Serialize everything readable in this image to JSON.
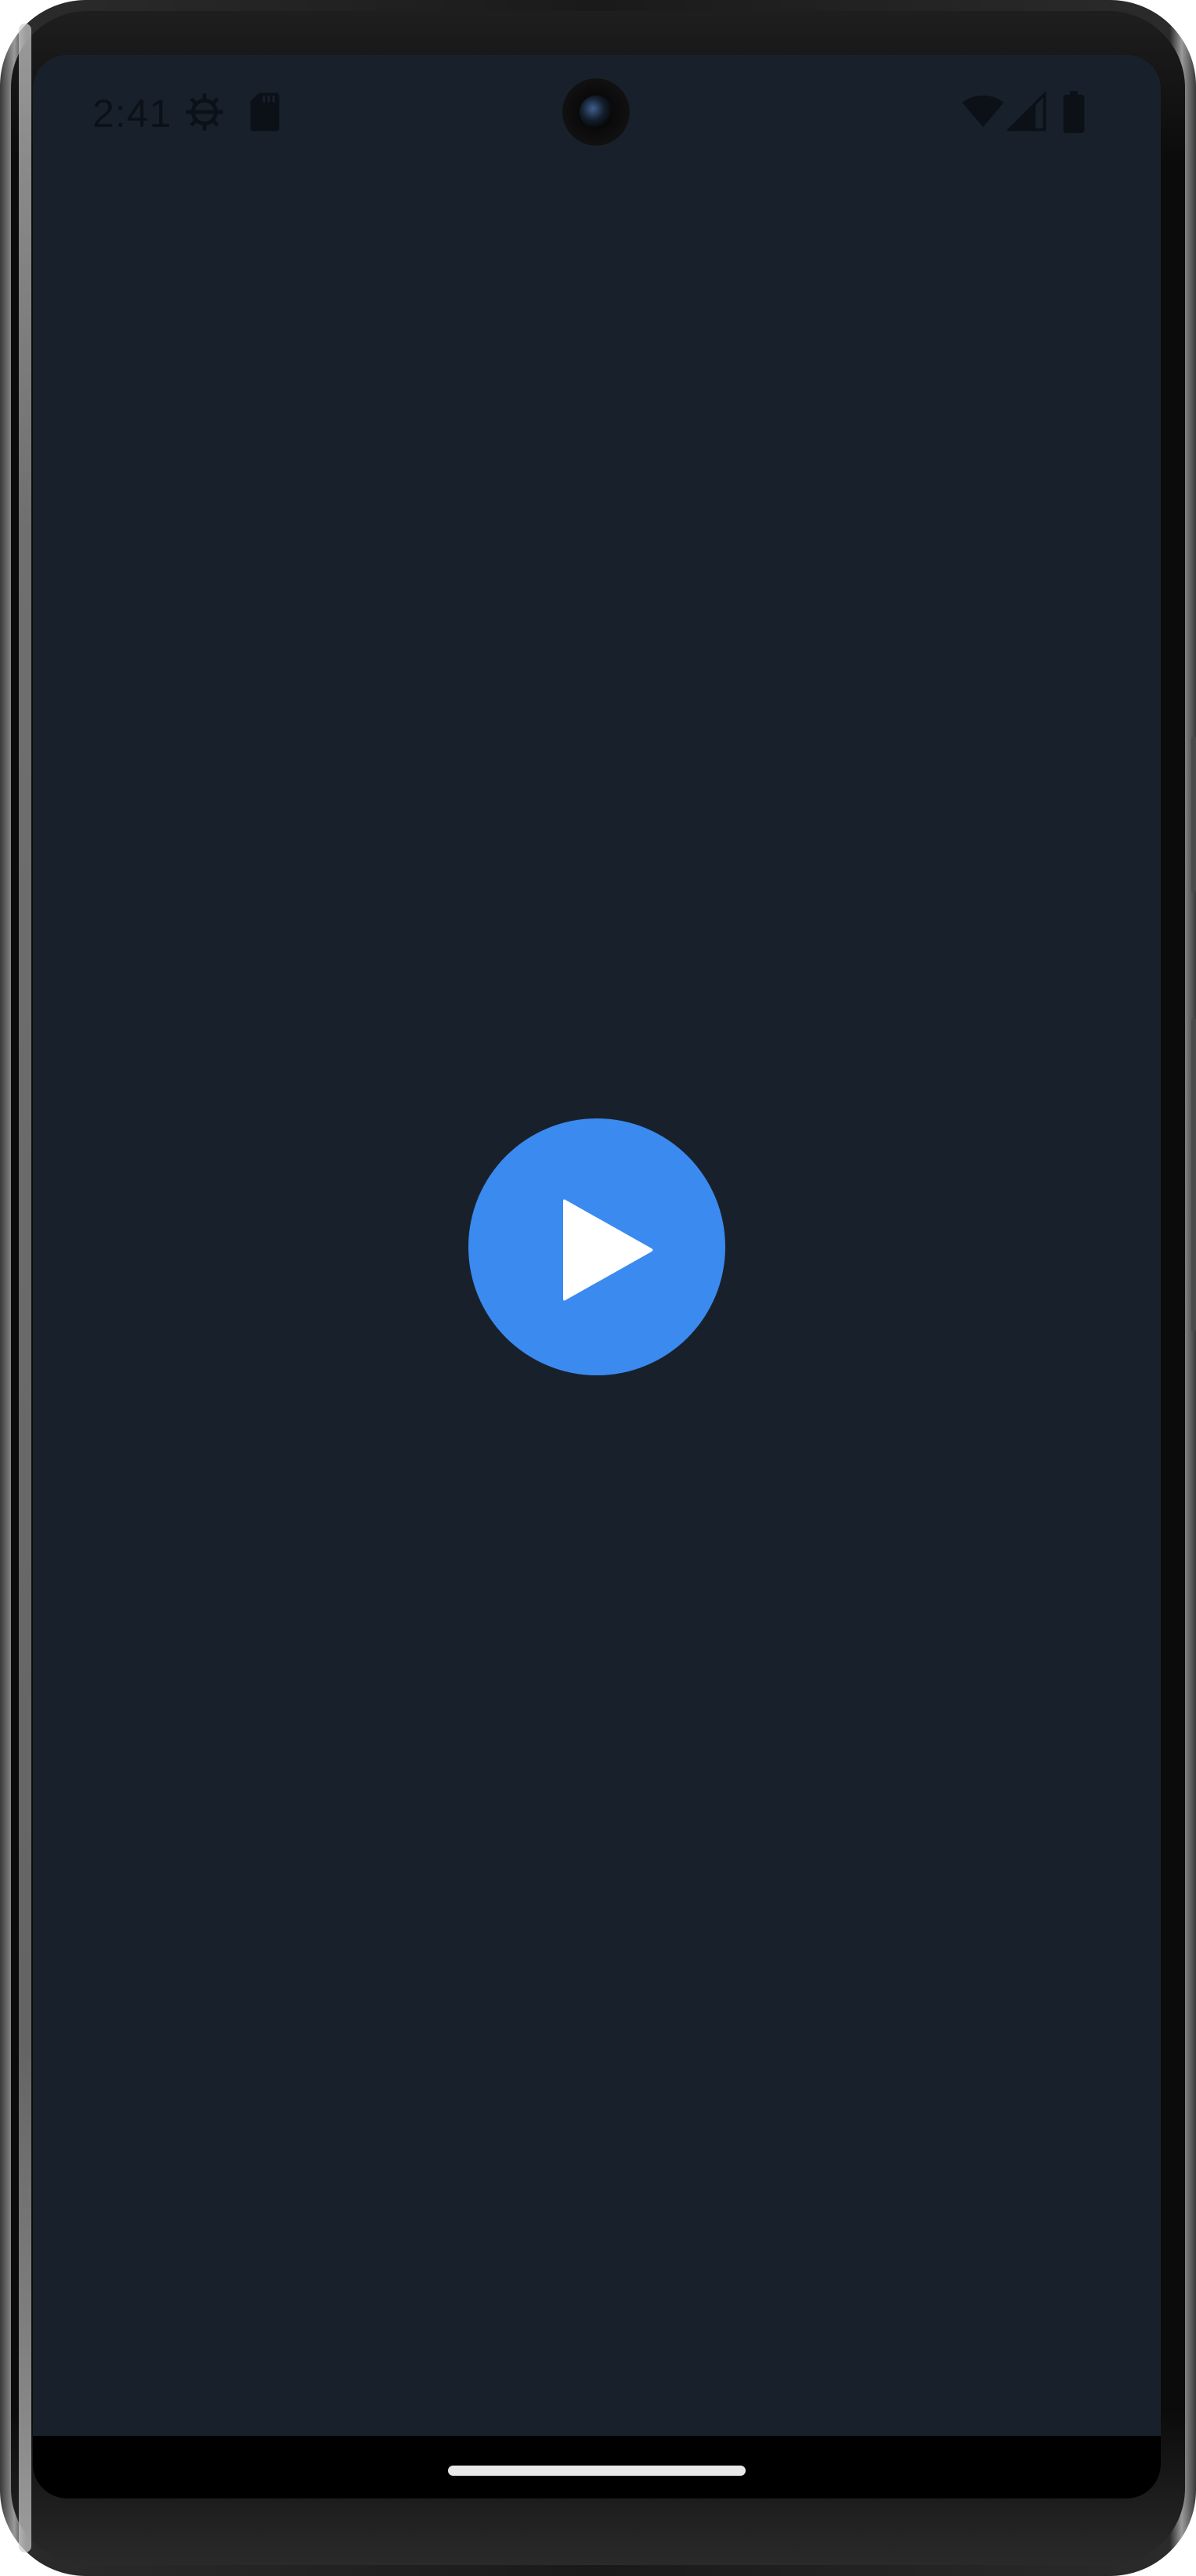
{
  "status_bar": {
    "time": "2:41",
    "left_icons": [
      "gear-icon",
      "sdcard-icon"
    ],
    "right_icons": [
      "wifi-icon",
      "signal-icon",
      "battery-icon"
    ]
  },
  "main": {
    "play_button": {
      "icon": "play-icon",
      "color": "#3b8aef"
    },
    "background_color": "#18212b"
  },
  "navigation": {
    "home_indicator": "home-indicator"
  },
  "device": {
    "frame": "smartphone"
  }
}
